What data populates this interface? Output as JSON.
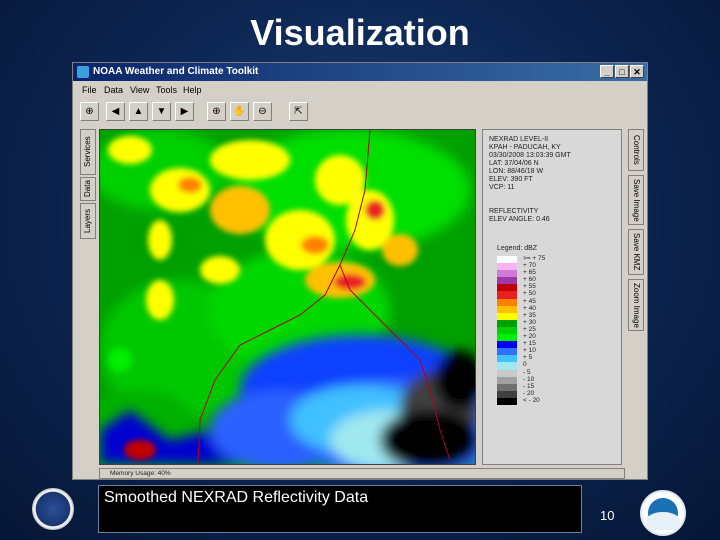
{
  "slide": {
    "title": "Visualization",
    "caption": "Smoothed NEXRAD Reflectivity Data",
    "page_number": "10"
  },
  "window": {
    "title": "NOAA Weather and Climate Toolkit",
    "controls": [
      "_",
      "□",
      "✕"
    ],
    "menu": [
      "File",
      "Data",
      "View",
      "Tools",
      "Help"
    ],
    "left_tabs": [
      "Services",
      "Data",
      "Layers"
    ],
    "right_tabs": [
      "Controls",
      "Save Image",
      "Save KMZ",
      "Zoom Image"
    ]
  },
  "info_panel": {
    "lines": [
      "NEXRAD LEVEL-II",
      "KPAH - PADUCAH, KY",
      "03/30/2008 13:03:39 GMT",
      "LAT: 37/04/06 N",
      "LON: 88/46/18 W",
      "ELEV: 390 FT",
      "VCP: 11",
      "",
      "REFLECTIVITY",
      "ELEV ANGLE: 0.46"
    ],
    "legend_title": "Legend: dBZ",
    "legend": [
      {
        "label": ">= + 75",
        "color": "#ffffff"
      },
      {
        "label": "+ 70",
        "color": "#f5b5f5"
      },
      {
        "label": "+ 65",
        "color": "#d07ad8"
      },
      {
        "label": "+ 60",
        "color": "#9a3aa8"
      },
      {
        "label": "+ 55",
        "color": "#c00000"
      },
      {
        "label": "+ 50",
        "color": "#e82020"
      },
      {
        "label": "+ 45",
        "color": "#ff8000"
      },
      {
        "label": "+ 40",
        "color": "#ffc000"
      },
      {
        "label": "+ 35",
        "color": "#ffff00"
      },
      {
        "label": "+ 30",
        "color": "#00a000"
      },
      {
        "label": "+ 25",
        "color": "#00d000"
      },
      {
        "label": "+ 20",
        "color": "#00f000"
      },
      {
        "label": "+ 15",
        "color": "#0000f0"
      },
      {
        "label": "+ 10",
        "color": "#3070ff"
      },
      {
        "label": "+ 5",
        "color": "#40c0ff"
      },
      {
        "label": "0",
        "color": "#a0e8f0"
      },
      {
        "label": "- 5",
        "color": "#c8c8c8"
      },
      {
        "label": "- 10",
        "color": "#a0a0a0"
      },
      {
        "label": "- 15",
        "color": "#707070"
      },
      {
        "label": "- 20",
        "color": "#404040"
      },
      {
        "label": "< - 20",
        "color": "#000000"
      }
    ]
  },
  "status": {
    "memory": "Memory Usage: 40%"
  }
}
